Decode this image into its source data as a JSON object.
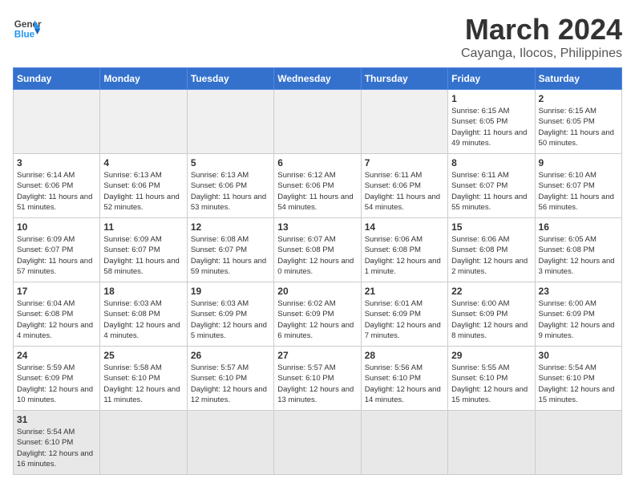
{
  "header": {
    "logo_general": "General",
    "logo_blue": "Blue",
    "title": "March 2024",
    "subtitle": "Cayanga, Ilocos, Philippines"
  },
  "weekdays": [
    "Sunday",
    "Monday",
    "Tuesday",
    "Wednesday",
    "Thursday",
    "Friday",
    "Saturday"
  ],
  "weeks": [
    [
      {
        "day": "",
        "info": ""
      },
      {
        "day": "",
        "info": ""
      },
      {
        "day": "",
        "info": ""
      },
      {
        "day": "",
        "info": ""
      },
      {
        "day": "",
        "info": ""
      },
      {
        "day": "1",
        "info": "Sunrise: 6:15 AM\nSunset: 6:05 PM\nDaylight: 11 hours and 49 minutes."
      },
      {
        "day": "2",
        "info": "Sunrise: 6:15 AM\nSunset: 6:05 PM\nDaylight: 11 hours and 50 minutes."
      }
    ],
    [
      {
        "day": "3",
        "info": "Sunrise: 6:14 AM\nSunset: 6:06 PM\nDaylight: 11 hours and 51 minutes."
      },
      {
        "day": "4",
        "info": "Sunrise: 6:13 AM\nSunset: 6:06 PM\nDaylight: 11 hours and 52 minutes."
      },
      {
        "day": "5",
        "info": "Sunrise: 6:13 AM\nSunset: 6:06 PM\nDaylight: 11 hours and 53 minutes."
      },
      {
        "day": "6",
        "info": "Sunrise: 6:12 AM\nSunset: 6:06 PM\nDaylight: 11 hours and 54 minutes."
      },
      {
        "day": "7",
        "info": "Sunrise: 6:11 AM\nSunset: 6:06 PM\nDaylight: 11 hours and 54 minutes."
      },
      {
        "day": "8",
        "info": "Sunrise: 6:11 AM\nSunset: 6:07 PM\nDaylight: 11 hours and 55 minutes."
      },
      {
        "day": "9",
        "info": "Sunrise: 6:10 AM\nSunset: 6:07 PM\nDaylight: 11 hours and 56 minutes."
      }
    ],
    [
      {
        "day": "10",
        "info": "Sunrise: 6:09 AM\nSunset: 6:07 PM\nDaylight: 11 hours and 57 minutes."
      },
      {
        "day": "11",
        "info": "Sunrise: 6:09 AM\nSunset: 6:07 PM\nDaylight: 11 hours and 58 minutes."
      },
      {
        "day": "12",
        "info": "Sunrise: 6:08 AM\nSunset: 6:07 PM\nDaylight: 11 hours and 59 minutes."
      },
      {
        "day": "13",
        "info": "Sunrise: 6:07 AM\nSunset: 6:08 PM\nDaylight: 12 hours and 0 minutes."
      },
      {
        "day": "14",
        "info": "Sunrise: 6:06 AM\nSunset: 6:08 PM\nDaylight: 12 hours and 1 minute."
      },
      {
        "day": "15",
        "info": "Sunrise: 6:06 AM\nSunset: 6:08 PM\nDaylight: 12 hours and 2 minutes."
      },
      {
        "day": "16",
        "info": "Sunrise: 6:05 AM\nSunset: 6:08 PM\nDaylight: 12 hours and 3 minutes."
      }
    ],
    [
      {
        "day": "17",
        "info": "Sunrise: 6:04 AM\nSunset: 6:08 PM\nDaylight: 12 hours and 4 minutes."
      },
      {
        "day": "18",
        "info": "Sunrise: 6:03 AM\nSunset: 6:08 PM\nDaylight: 12 hours and 4 minutes."
      },
      {
        "day": "19",
        "info": "Sunrise: 6:03 AM\nSunset: 6:09 PM\nDaylight: 12 hours and 5 minutes."
      },
      {
        "day": "20",
        "info": "Sunrise: 6:02 AM\nSunset: 6:09 PM\nDaylight: 12 hours and 6 minutes."
      },
      {
        "day": "21",
        "info": "Sunrise: 6:01 AM\nSunset: 6:09 PM\nDaylight: 12 hours and 7 minutes."
      },
      {
        "day": "22",
        "info": "Sunrise: 6:00 AM\nSunset: 6:09 PM\nDaylight: 12 hours and 8 minutes."
      },
      {
        "day": "23",
        "info": "Sunrise: 6:00 AM\nSunset: 6:09 PM\nDaylight: 12 hours and 9 minutes."
      }
    ],
    [
      {
        "day": "24",
        "info": "Sunrise: 5:59 AM\nSunset: 6:09 PM\nDaylight: 12 hours and 10 minutes."
      },
      {
        "day": "25",
        "info": "Sunrise: 5:58 AM\nSunset: 6:10 PM\nDaylight: 12 hours and 11 minutes."
      },
      {
        "day": "26",
        "info": "Sunrise: 5:57 AM\nSunset: 6:10 PM\nDaylight: 12 hours and 12 minutes."
      },
      {
        "day": "27",
        "info": "Sunrise: 5:57 AM\nSunset: 6:10 PM\nDaylight: 12 hours and 13 minutes."
      },
      {
        "day": "28",
        "info": "Sunrise: 5:56 AM\nSunset: 6:10 PM\nDaylight: 12 hours and 14 minutes."
      },
      {
        "day": "29",
        "info": "Sunrise: 5:55 AM\nSunset: 6:10 PM\nDaylight: 12 hours and 15 minutes."
      },
      {
        "day": "30",
        "info": "Sunrise: 5:54 AM\nSunset: 6:10 PM\nDaylight: 12 hours and 15 minutes."
      }
    ],
    [
      {
        "day": "31",
        "info": "Sunrise: 5:54 AM\nSunset: 6:10 PM\nDaylight: 12 hours and 16 minutes."
      },
      {
        "day": "",
        "info": ""
      },
      {
        "day": "",
        "info": ""
      },
      {
        "day": "",
        "info": ""
      },
      {
        "day": "",
        "info": ""
      },
      {
        "day": "",
        "info": ""
      },
      {
        "day": "",
        "info": ""
      }
    ]
  ]
}
